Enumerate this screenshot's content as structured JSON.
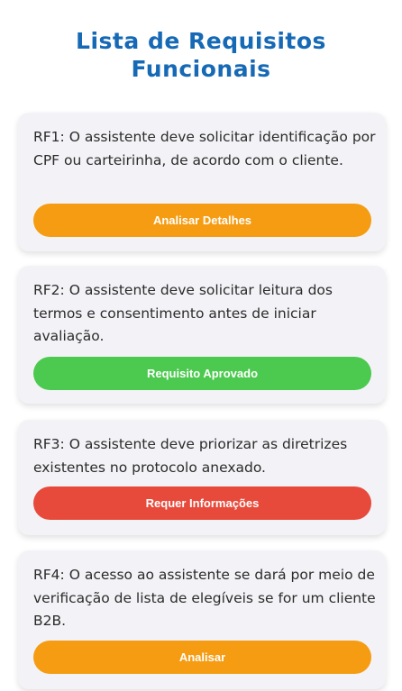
{
  "page": {
    "title_line1": "Lista de Requisitos",
    "title_line2": "Funcionais"
  },
  "colors": {
    "title": "#1669b5",
    "card_bg": "#f3f3f7",
    "orange": "#f59c12",
    "green": "#4cc94f",
    "red": "#e74a3b"
  },
  "requirements": [
    {
      "text": "RF1: O assistente deve solicitar identificação por CPF ou carteirinha, de acordo com o cliente.",
      "button_label": "Analisar Detalhes",
      "button_color": "#f59c12"
    },
    {
      "text": "RF2: O assistente deve solicitar leitura dos termos e consentimento antes de iniciar avaliação.",
      "button_label": "Requisito Aprovado",
      "button_color": "#4cc94f"
    },
    {
      "text": "RF3: O assistente deve priorizar as diretrizes existentes no protocolo anexado.",
      "button_label": "Requer Informações",
      "button_color": "#e74a3b"
    },
    {
      "text": "RF4: O acesso ao assistente se dará por meio de verificação de lista de elegíveis se for um cliente B2B.",
      "button_label": "Analisar",
      "button_color": "#f59c12"
    }
  ]
}
